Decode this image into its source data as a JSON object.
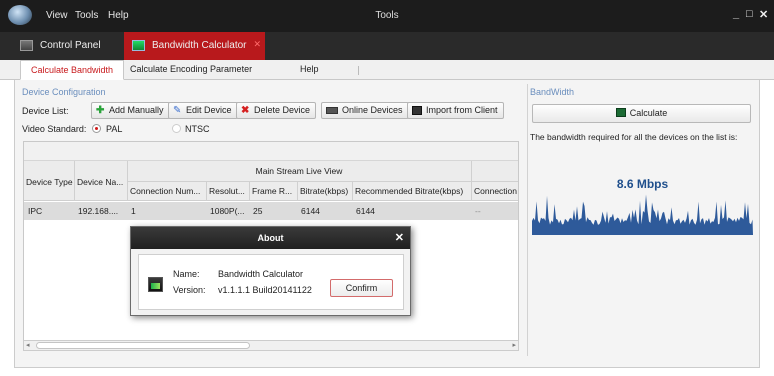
{
  "menubar": {
    "view": "View",
    "tools": "Tools",
    "help": "Help",
    "window_title": "Tools"
  },
  "window_controls": {
    "minimize": "_",
    "maximize": "□",
    "close": "✕"
  },
  "app_tabs": [
    {
      "label": "Control Panel"
    },
    {
      "label": "Bandwidth Calculator",
      "close": "✕"
    }
  ],
  "subtabs": [
    {
      "label": "Calculate Bandwidth"
    },
    {
      "label": "Calculate Encoding Parameter"
    },
    {
      "label": "Help"
    }
  ],
  "device_config": {
    "section_title": "Device Configuration",
    "device_list_label": "Device List:",
    "buttons": {
      "add_manually": "Add Manually",
      "edit_device": "Edit Device",
      "delete_device": "Delete Device",
      "online_devices": "Online Devices",
      "import_from_client": "Import from Client"
    },
    "video_standard_label": "Video Standard:",
    "pal": "PAL",
    "ntsc": "NTSC",
    "selected_standard": "PAL"
  },
  "table": {
    "col_device_type": "Device Type",
    "col_device_name": "Device Na...",
    "group_header": "Main Stream Live View",
    "sub_headers": [
      "Connection Num...",
      "Resolut...",
      "Frame R...",
      "Bitrate(kbps)",
      "Recommended Bitrate(kbps)",
      "Connection"
    ],
    "rows": [
      {
        "device_type": "IPC",
        "device_name": "192.168....",
        "connection_num": "1",
        "resolution": "1080P(...",
        "frame_rate": "25",
        "bitrate": "6144",
        "recommended_bitrate": "6144",
        "connection": "--"
      }
    ]
  },
  "bandwidth": {
    "section_title": "BandWidth",
    "calculate_label": "Calculate",
    "description": "The bandwidth required for all the devices on the list is:",
    "value": "8.6 Mbps",
    "graph_color": "#2e5a9a"
  },
  "about_dialog": {
    "title": "About",
    "close": "✕",
    "name_label": "Name:",
    "name_value": "Bandwidth Calculator",
    "version_label": "Version:",
    "version_value": "v1.1.1.1 Build20141122",
    "confirm_label": "Confirm"
  }
}
